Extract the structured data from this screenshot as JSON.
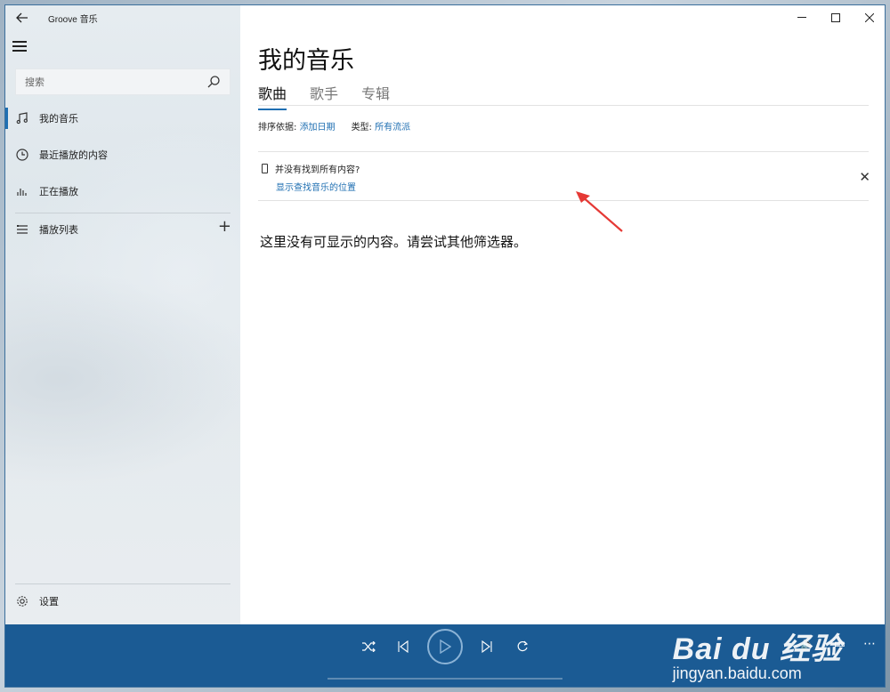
{
  "app": {
    "title": "Groove 音乐"
  },
  "sidebar": {
    "search_placeholder": "搜索",
    "items": [
      {
        "icon": "music-note-icon",
        "label": "我的音乐"
      },
      {
        "icon": "clock-icon",
        "label": "最近播放的内容"
      },
      {
        "icon": "equalizer-icon",
        "label": "正在播放"
      },
      {
        "icon": "playlist-icon",
        "label": "播放列表"
      }
    ],
    "settings_label": "设置"
  },
  "main": {
    "page_title": "我的音乐",
    "tabs": [
      {
        "label": "歌曲",
        "active": true
      },
      {
        "label": "歌手",
        "active": false
      },
      {
        "label": "专辑",
        "active": false
      }
    ],
    "sort_label": "排序依据:",
    "sort_value": "添加日期",
    "genre_label": "类型:",
    "genre_value": "所有流派",
    "notice_title": "并没有找到所有内容?",
    "notice_link": "显示查找音乐的位置",
    "empty_message": "这里没有可显示的内容。请尝试其他筛选器。"
  },
  "watermark": {
    "main": "Bai du 经验",
    "sub": "jingyan.baidu.com"
  },
  "colors": {
    "accent": "#1f6fb2",
    "player_bg": "#1b5b94"
  }
}
